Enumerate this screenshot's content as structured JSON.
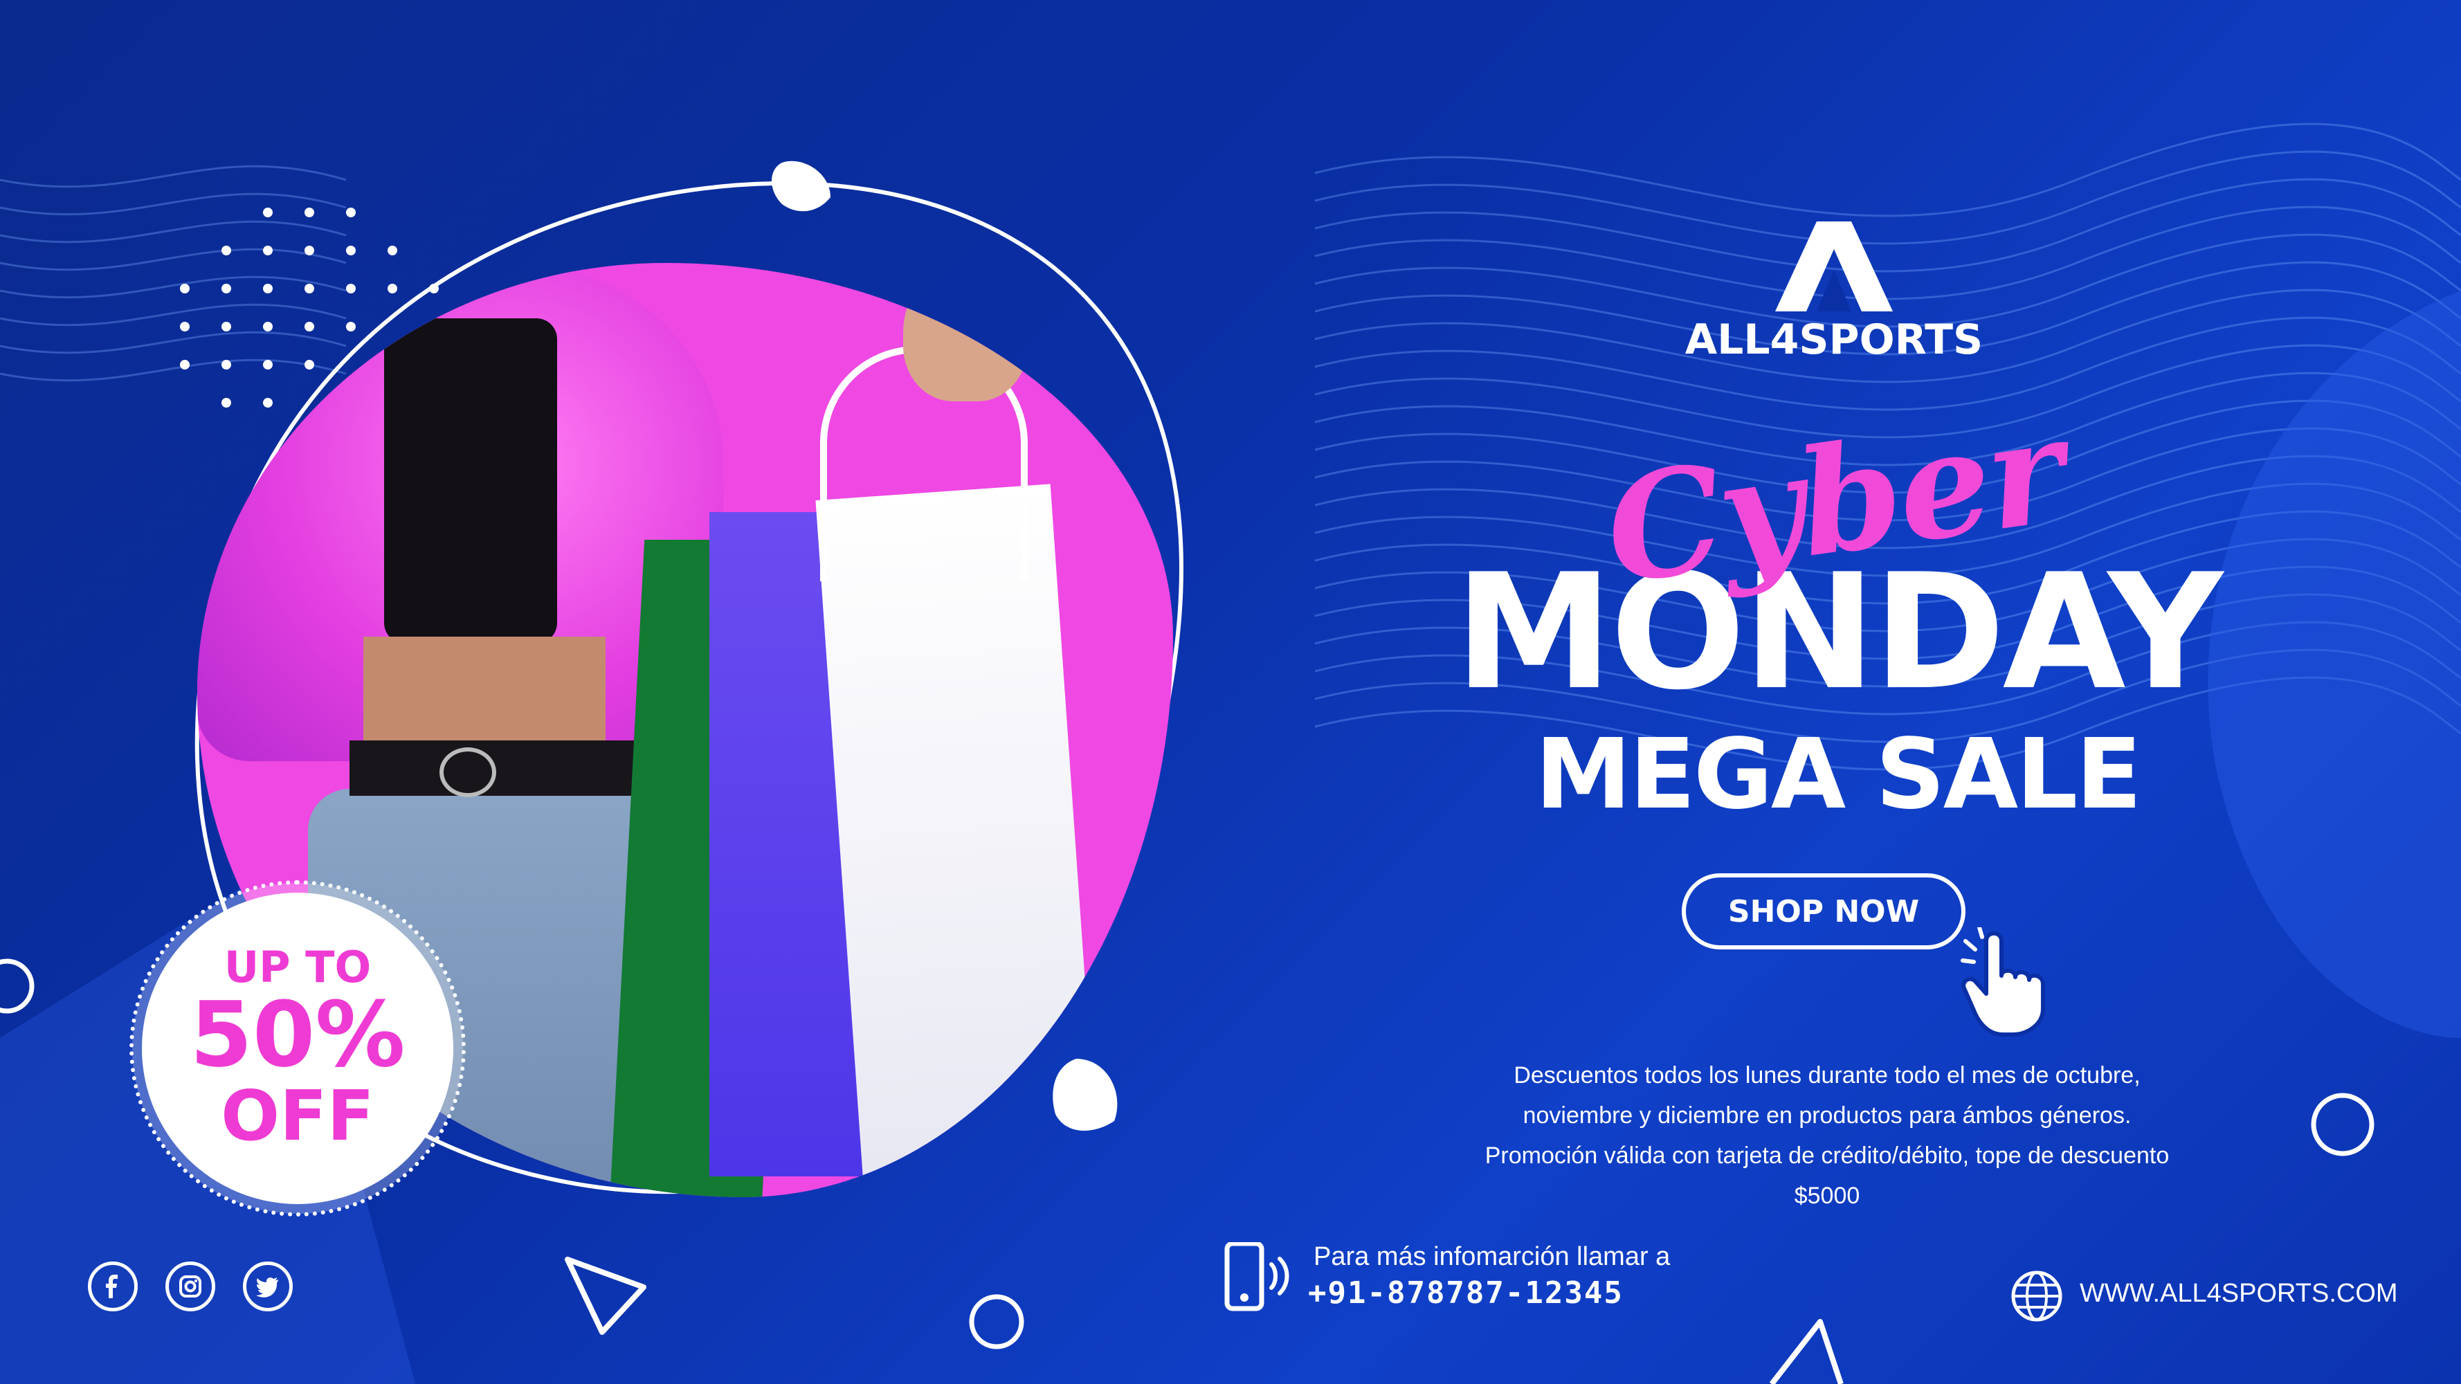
{
  "brand": {
    "name": "ALL4SPORTS"
  },
  "headline": {
    "script": "Cyber",
    "main": "MONDAY",
    "sub": "MEGA SALE"
  },
  "cta": {
    "label": "SHOP NOW"
  },
  "discount": {
    "line1": "UP TO",
    "line2": "50%",
    "line3": "OFF"
  },
  "description": [
    "Descuentos todos los lunes durante todo el mes de octubre,",
    "noviembre y diciembre en productos para ámbos géneros.",
    "Promoción válida con tarjeta de crédito/débito, tope de descuento",
    "$5000"
  ],
  "contact": {
    "call_text": "Para más infomarción llamar a",
    "phone": "+91-878787-12345"
  },
  "website": "WWW.ALL4SPORTS.COM",
  "social": [
    "facebook-icon",
    "instagram-icon",
    "twitter-icon"
  ],
  "colors": {
    "background": "#0b2fa5",
    "accent": "#f24ad8",
    "text": "#ffffff"
  }
}
